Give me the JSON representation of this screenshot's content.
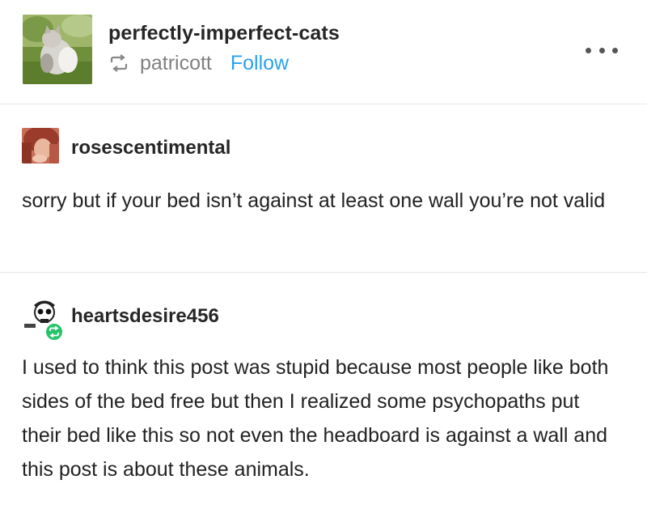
{
  "header": {
    "blog_name": "perfectly-imperfect-cats",
    "reblogged_from": "patricott",
    "follow_label": "Follow",
    "avatar_icon": "cat-photo-avatar",
    "reblog_icon": "reblog-icon",
    "more_icon": "more-dots-icon"
  },
  "colors": {
    "follow": "#2aa2f0",
    "reblog_badge": "#27c46b"
  },
  "thread": [
    {
      "username": "rosescentimental",
      "avatar_icon": "user-avatar-red-hair",
      "text": "sorry but if your bed isn’t against at least one wall you’re not valid"
    },
    {
      "username": "heartsdesire456",
      "avatar_icon": "user-avatar-skull",
      "badge_icon": "reblog-badge-icon",
      "text": "I used to think this post was stupid because most people like both sides of the bed free but then I realized some psychopaths put their bed like this so not even the headboard is against a wall and this post is about these animals."
    }
  ]
}
